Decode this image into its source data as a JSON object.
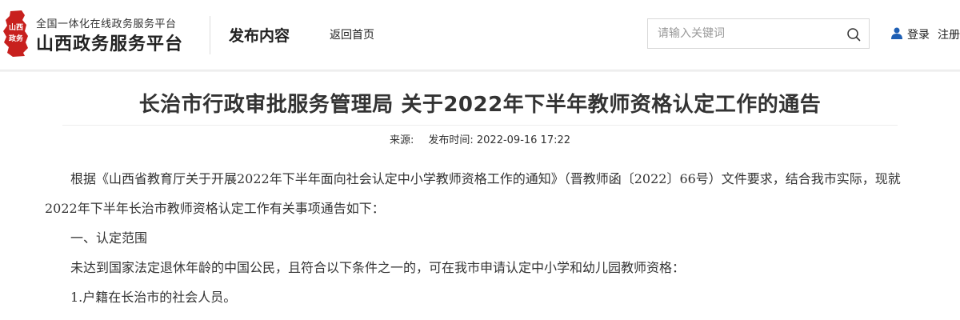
{
  "header": {
    "logo": {
      "subtitle": "全国一体化在线政务服务平台",
      "title": "山西政务服务平台",
      "emblem_text": "山西政务",
      "emblem_color": "#c8201e"
    },
    "section_title": "发布内容",
    "back_home_label": "返回首页",
    "search": {
      "placeholder": "请输入关键词",
      "value": "",
      "icon": "search-icon"
    },
    "login_label": "登录",
    "register_label": "注册",
    "user_icon_color": "#1e5fb4"
  },
  "article": {
    "title": "长治市行政审批服务管理局 关于2022年下半年教师资格认定工作的通告",
    "source_label": "来源:",
    "source_value": "",
    "publish_label": "发布时间:",
    "publish_time": "2022-09-16 17:22",
    "paragraphs": [
      "根据《山西省教育厅关于开展2022年下半年面向社会认定中小学教师资格工作的通知》（晋教师函〔2022〕66号）文件要求，结合我市实际，现就2022年下半年长治市教师资格认定工作有关事项通告如下：",
      "一、认定范围",
      "未达到国家法定退休年龄的中国公民，且符合以下条件之一的，可在我市申请认定中小学和幼儿园教师资格：",
      "1.户籍在长治市的社会人员。"
    ]
  }
}
